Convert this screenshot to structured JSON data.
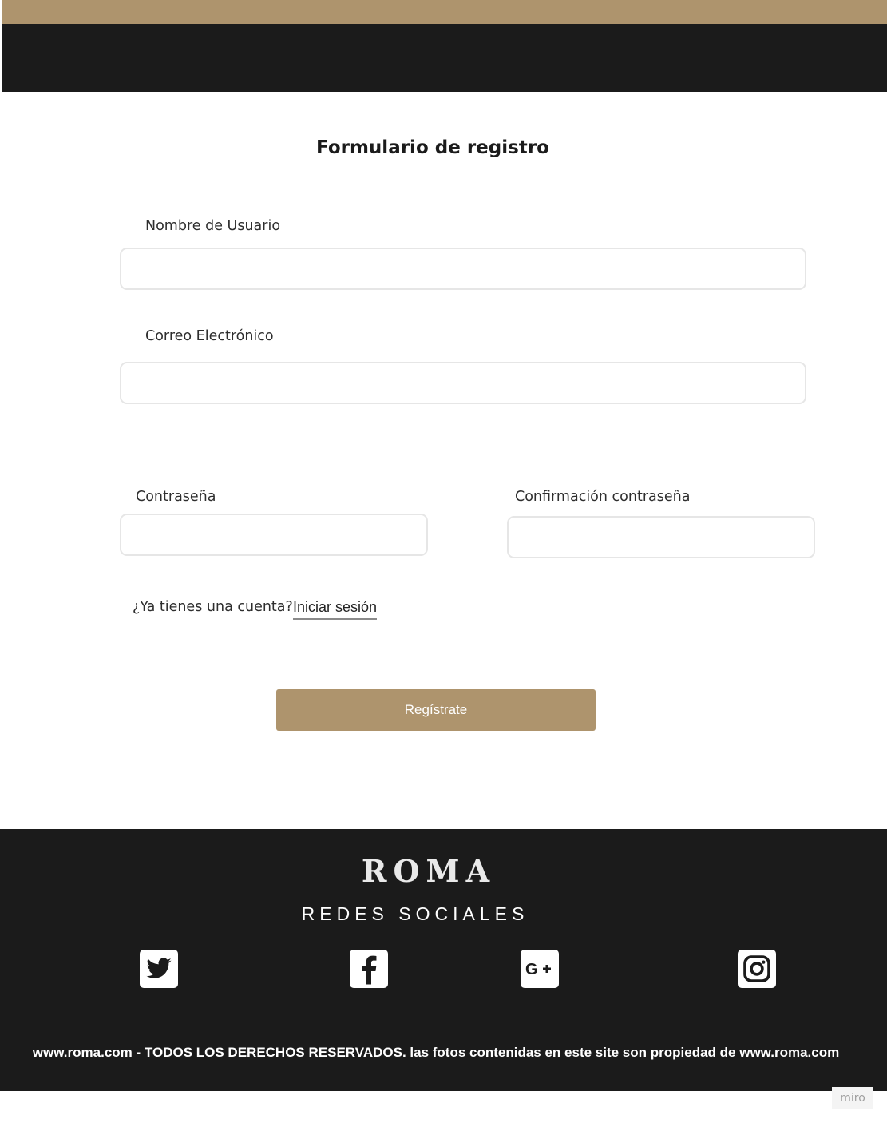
{
  "form": {
    "title": "Formulario de registro",
    "username_label": "Nombre de Usuario",
    "username_value": "",
    "email_label": "Correo Electrónico",
    "email_value": "",
    "password_label": "Contraseña",
    "password_value": "",
    "confirm_label": "Confirmación contraseña",
    "confirm_value": "",
    "account_question": "¿Ya tienes una cuenta?",
    "login_link": "Iniciar sesión",
    "register_button": "Regístrate"
  },
  "footer": {
    "brand": "ROMA",
    "social_title": "REDES SOCIALES",
    "social_icons": [
      "twitter-icon",
      "facebook-icon",
      "google-plus-icon",
      "instagram-icon"
    ],
    "site_link": "www.roma.com",
    "rights_text": " - TODOS LOS DERECHOS RESERVADOS. las fotos contenidas en este site son propiedad de ",
    "site_link_2": "www.roma.com"
  },
  "badge": "miro",
  "colors": {
    "accent_gold": "#ae946d",
    "dark": "#1b1b1b",
    "input_border": "#e6e6e6"
  }
}
